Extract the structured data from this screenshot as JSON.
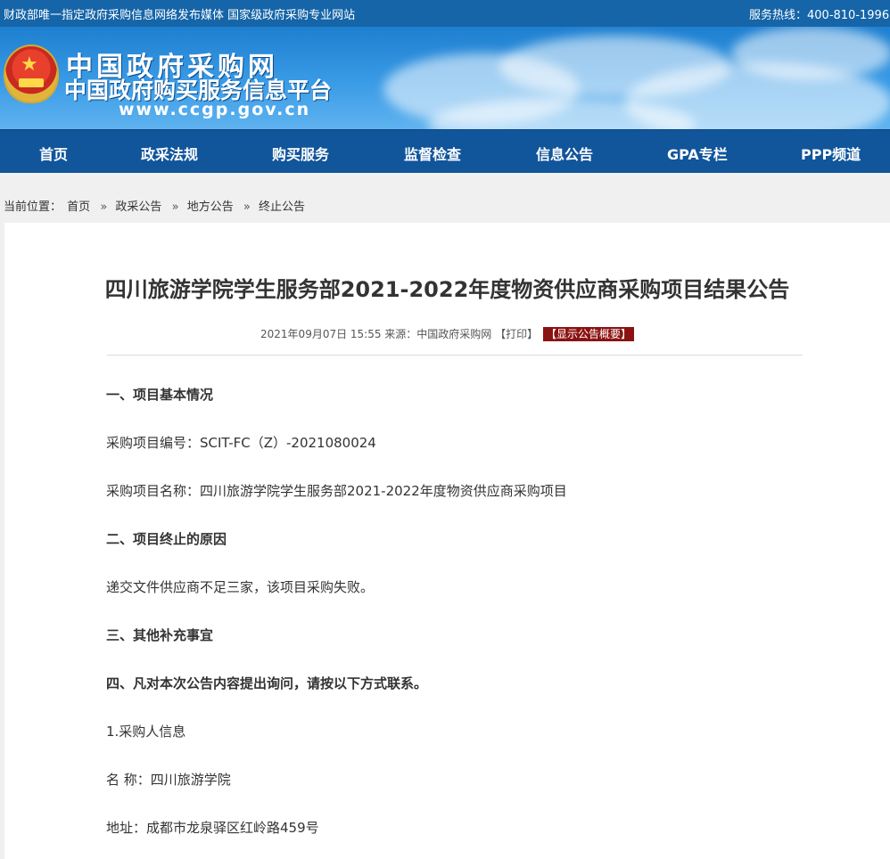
{
  "topbar": {
    "slogan": "财政部唯一指定政府采购信息网络发布媒体 国家级政府采购专业网站",
    "hotline": "服务热线：400-810-1996"
  },
  "header": {
    "logo_title": "中国政府采购网",
    "logo_subtitle": "中国政府购买服务信息平台",
    "logo_url": "www.ccgp.gov.cn",
    "emblem_icon": "national-emblem-icon"
  },
  "nav": {
    "items": [
      {
        "label": "首页"
      },
      {
        "label": "政采法规"
      },
      {
        "label": "购买服务"
      },
      {
        "label": "监督检查"
      },
      {
        "label": "信息公告"
      },
      {
        "label": "GPA专栏"
      },
      {
        "label": "PPP频道"
      }
    ]
  },
  "breadcrumb": {
    "prefix": "当前位置：",
    "items": [
      "首页",
      "政采公告",
      "地方公告",
      "终止公告"
    ],
    "separator": "»"
  },
  "article": {
    "title": "四川旅游学院学生服务部2021-2022年度物资供应商采购项目结果公告",
    "meta_text": "2021年09月07日 15:55 来源：中国政府采购网 ",
    "print_label": "【打印】",
    "summary_label": "【显示公告概要】",
    "paragraphs": [
      {
        "text": "一、项目基本情况",
        "bold": true
      },
      {
        "text": "采购项目编号：SCIT-FC（Z）-2021080024",
        "bold": false
      },
      {
        "text": "采购项目名称：四川旅游学院学生服务部2021-2022年度物资供应商采购项目",
        "bold": false
      },
      {
        "text": "二、项目终止的原因",
        "bold": true
      },
      {
        "text": "递交文件供应商不足三家，该项目采购失败。",
        "bold": false
      },
      {
        "text": "三、其他补充事宜",
        "bold": true
      },
      {
        "text": "四、凡对本次公告内容提出询问，请按以下方式联系。",
        "bold": true
      },
      {
        "text": "1.采购人信息",
        "bold": false
      },
      {
        "text": "名 称：四川旅游学院",
        "bold": false
      },
      {
        "text": "地址：成都市龙泉驿区红岭路459号",
        "bold": false
      }
    ]
  },
  "colors": {
    "topbar": "#1565a8",
    "nav": "#11559b",
    "summary_tag": "#8b1212"
  }
}
